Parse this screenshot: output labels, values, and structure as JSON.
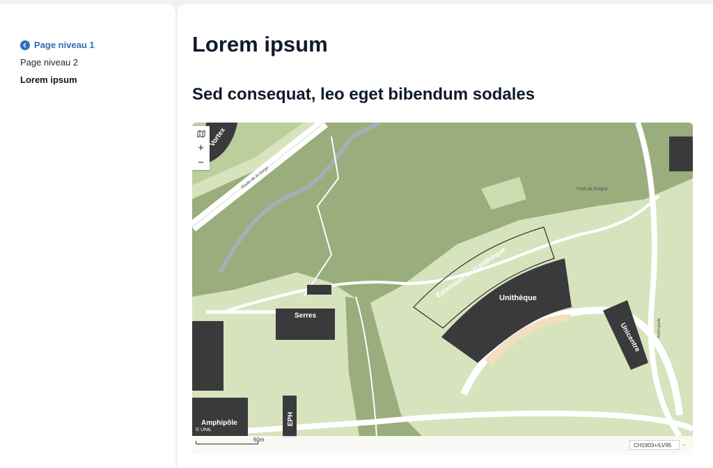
{
  "sidebar": {
    "back_label": "Page niveau 1",
    "items": [
      {
        "label": "Page niveau 2"
      },
      {
        "label": "Lorem ipsum"
      }
    ]
  },
  "main": {
    "title": "Lorem ipsum",
    "subtitle": "Sed consequat, leo eget bibendum sodales"
  },
  "map": {
    "controls": {
      "layers_icon": "map-icon",
      "zoom_in": "+",
      "zoom_out": "−"
    },
    "labels": {
      "vortex": "Vortex",
      "route": "Route de la Sorge",
      "foret": "Forêt de Dorigny",
      "extension": "Extension de l'Unithèque",
      "unitheque": "Unithèque",
      "unicentre": "Unicentre",
      "serres": "Serres",
      "amphipole": "Amphipôle",
      "eph": "EPH",
      "anthropole": "Anthropole"
    },
    "attribution": "© UNIL",
    "scale_label": "60m",
    "crs_value": "CH1903+/LV95",
    "colors": {
      "forest": "#9aad7d",
      "grass": "#d7e3bd",
      "building": "#3a3a3c",
      "water": "#a7aeb6",
      "road": "#ffffff",
      "sand": "#f1dfbf"
    }
  }
}
